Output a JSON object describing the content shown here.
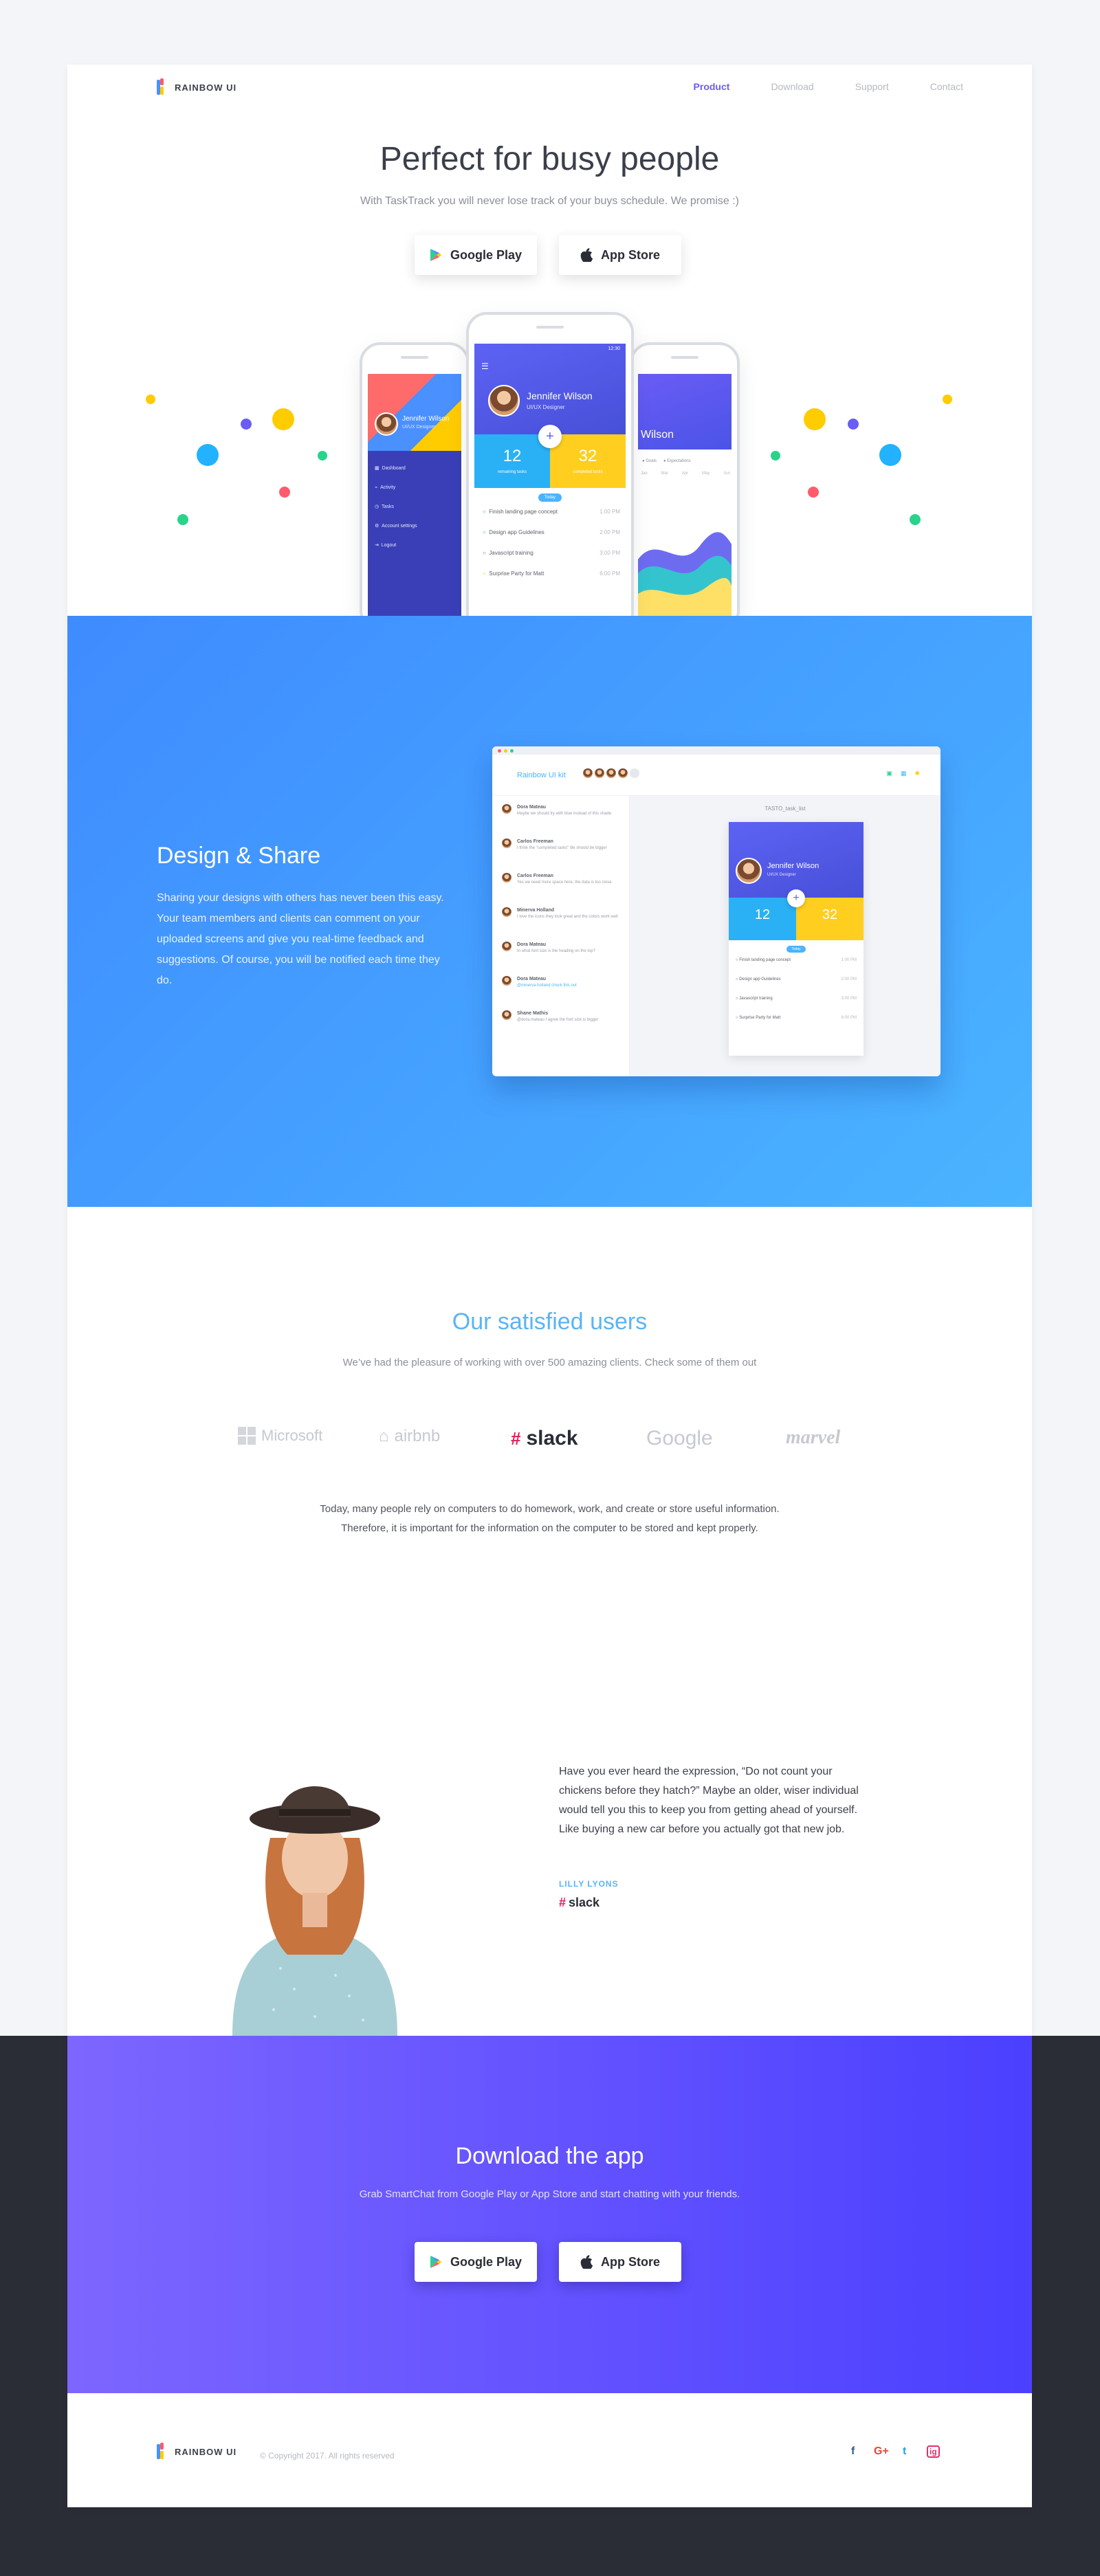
{
  "brand": {
    "name": "RAINBOW UI"
  },
  "nav": [
    {
      "label": "Product",
      "active": true
    },
    {
      "label": "Download",
      "active": false
    },
    {
      "label": "Support",
      "active": false
    },
    {
      "label": "Contact",
      "active": false
    }
  ],
  "hero": {
    "title": "Perfect for busy people",
    "subtitle": "With TaskTrack you will never lose track of your buys schedule. We promise :)",
    "google_play": "Google Play",
    "app_store": "App Store"
  },
  "phone_left": {
    "name": "Jennifer Wilson",
    "role": "UI/UX Designer",
    "menu": [
      "Dashboard",
      "Activity",
      "Tasks",
      "Account settings",
      "Logout"
    ]
  },
  "phone_center": {
    "name": "Jennifer Wilson",
    "role": "UI/UX Designer",
    "stat1_value": "12",
    "stat1_label": "remaining tasks",
    "stat2_value": "32",
    "stat2_label": "completed tasks",
    "badge": "Today",
    "time": "12:30",
    "tasks": [
      {
        "label": "Finish landing page concept",
        "time": "1:00 PM",
        "color": "#4a90ff"
      },
      {
        "label": "Design app Guidelines",
        "time": "2:00 PM",
        "color": "#2ad38b"
      },
      {
        "label": "Javascript training",
        "time": "3:00 PM",
        "color": "#5d5cf0"
      },
      {
        "label": "Surprise Party for Matt",
        "time": "6:00 PM",
        "color": "#ffcc00"
      }
    ]
  },
  "phone_right": {
    "name": "Wilson",
    "legend": [
      "Goals",
      "Expectations"
    ],
    "months": [
      "Jan",
      "Mar",
      "Apr",
      "May",
      "Jun"
    ]
  },
  "design": {
    "title": "Design & Share",
    "body": "Sharing your designs with others has never been this easy. Your team members and clients can comment on your uploaded screens and give you real-time feedback and suggestions. Of course, you will be notified each time they do.",
    "window": {
      "app_title": "Rainbow UI kit",
      "file_name": "TASTO_task_list",
      "comments": [
        {
          "name": "Dora Mateau",
          "text": "Maybe we should try with blue instead of this shade"
        },
        {
          "name": "Carlos Freeman",
          "text": "I think the \"completed tasks\" tile should be bigger"
        },
        {
          "name": "Carlos Freeman",
          "text": "Yes we need more space here, the data is too close"
        },
        {
          "name": "Minerva Holland",
          "text": "I love the icons they look great and the colors work well"
        },
        {
          "name": "Dora Mateau",
          "text": "In what font size is the heading on the top?"
        },
        {
          "name": "Dora Mateau",
          "text": "@minerva.holland check this out"
        },
        {
          "name": "Shane Mathis",
          "text": "@dora.mateau I agree the font size is bigger"
        }
      ]
    }
  },
  "users": {
    "title": "Our satisfied users",
    "subtitle": "We’ve had the pleasure of working with over 500 amazing clients. Check some of them out",
    "logos": [
      "Microsoft",
      "airbnb",
      "slack",
      "Google",
      "marvel"
    ],
    "paragraph_line1": "Today, many people rely on computers to do homework, work, and create or store useful information.",
    "paragraph_line2": "Therefore, it is important for the information on the computer to be stored and kept properly."
  },
  "testimonial": {
    "quote": "Have you ever heard the expression, “Do not count your chickens before they hatch?” Maybe an older, wiser individual would tell you this to keep you from getting ahead of yourself. Like buying a new car before you actually got that new job.",
    "name": "LILLY LYONS",
    "company": "slack"
  },
  "download": {
    "title": "Download the app",
    "subtitle": "Grab SmartChat from Google Play or App Store and start chatting with your friends.",
    "google_play": "Google Play",
    "app_store": "App Store"
  },
  "footer": {
    "brand": "RAINBOW UI",
    "copyright": "© Copyright 2017. All rights reserved",
    "social": [
      "f",
      "G+",
      "t",
      "ig"
    ]
  },
  "colors": {
    "accent": "#6a5cf6",
    "blue_section": "#3f8bff",
    "purple_section": "#6b55ff",
    "light_blue_text": "#5ab4f5"
  }
}
